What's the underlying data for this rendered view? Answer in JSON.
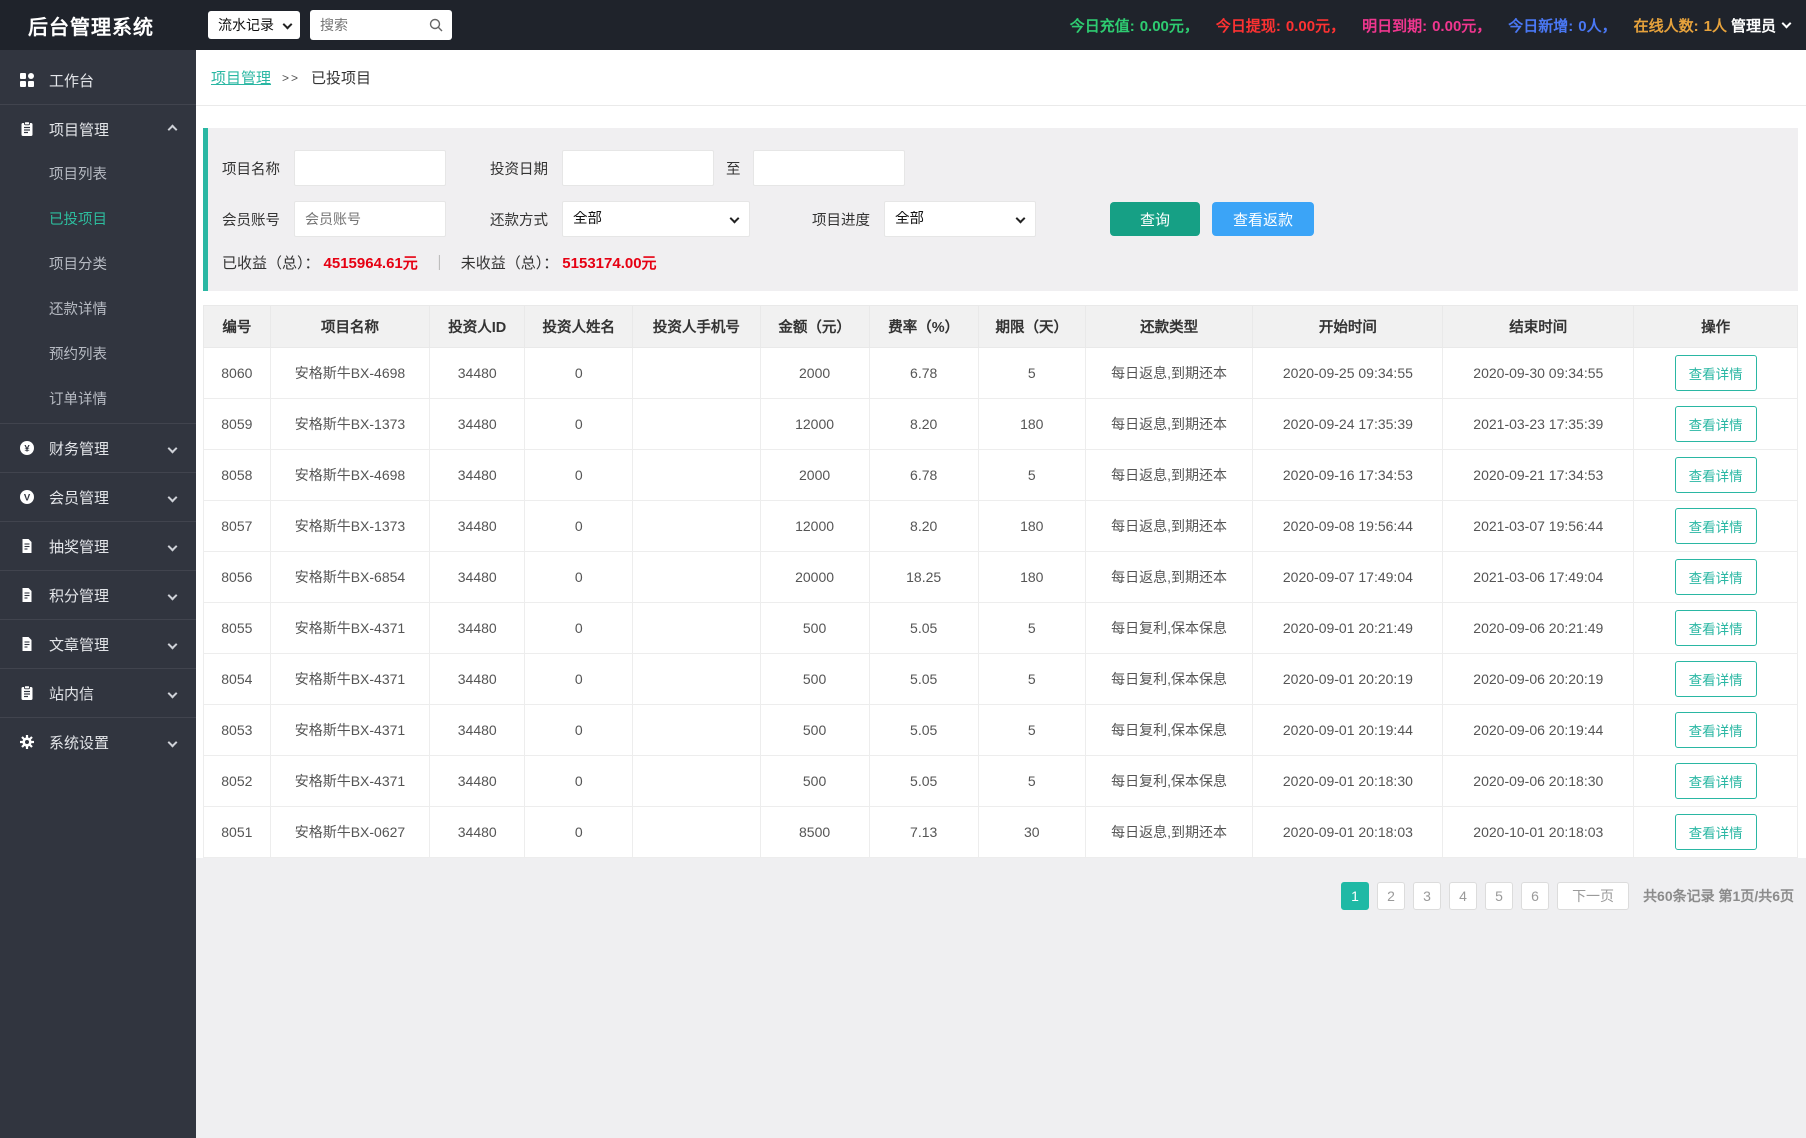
{
  "colors": {
    "accent": "#2ab7a3",
    "accent_dark": "#16a085",
    "blue": "#3ba4f7",
    "money_red": "#e60012"
  },
  "header": {
    "title": "后台管理系统",
    "nav_select": "流水记录",
    "search_placeholder": "搜索",
    "stats": [
      {
        "label": "今日充值:",
        "value": "0.00元，",
        "color": "#2ecc71"
      },
      {
        "label": "今日提现:",
        "value": "0.00元，",
        "color": "#fd3232"
      },
      {
        "label": "明日到期:",
        "value": "0.00元，",
        "color": "#f0368f"
      },
      {
        "label": "今日新增:",
        "value": "0人，",
        "color": "#4a78f5"
      },
      {
        "label": "在线人数:",
        "value": "1人",
        "color": "#e6a23c"
      }
    ],
    "admin_label": "管理员"
  },
  "sidebar": {
    "items": [
      {
        "key": "workbench",
        "label": "工作台",
        "icon": "dashboard-icon",
        "type": "top"
      },
      {
        "key": "project-management",
        "label": "项目管理",
        "icon": "clipboard-icon",
        "type": "group",
        "state": "expanded",
        "children": [
          {
            "key": "project-list",
            "label": "项目列表",
            "active": false
          },
          {
            "key": "invested-projects",
            "label": "已投项目",
            "active": true
          },
          {
            "key": "project-category",
            "label": "项目分类",
            "active": false
          },
          {
            "key": "repayment-details",
            "label": "还款详情",
            "active": false
          },
          {
            "key": "reservation-list",
            "label": "预约列表",
            "active": false
          },
          {
            "key": "order-details",
            "label": "订单详情",
            "active": false
          }
        ]
      },
      {
        "key": "finance-management",
        "label": "财务管理",
        "icon": "yen-circle-icon",
        "type": "group",
        "state": "collapsed"
      },
      {
        "key": "member-management",
        "label": "会员管理",
        "icon": "member-circle-icon",
        "type": "group",
        "state": "collapsed"
      },
      {
        "key": "lottery-management",
        "label": "抽奖管理",
        "icon": "document-icon",
        "type": "group",
        "state": "collapsed"
      },
      {
        "key": "points-management",
        "label": "积分管理",
        "icon": "document-icon",
        "type": "group",
        "state": "collapsed"
      },
      {
        "key": "article-management",
        "label": "文章管理",
        "icon": "document-icon",
        "type": "group",
        "state": "collapsed"
      },
      {
        "key": "site-mail",
        "label": "站内信",
        "icon": "clipboard-icon",
        "type": "group",
        "state": "collapsed"
      },
      {
        "key": "system-settings",
        "label": "系统设置",
        "icon": "gear-icon",
        "type": "group",
        "state": "collapsed"
      }
    ]
  },
  "breadcrumb": {
    "parent": "项目管理",
    "separator": ">>",
    "current": "已投项目"
  },
  "filters": {
    "project_name_label": "项目名称",
    "invest_date_label": "投资日期",
    "to_label": "至",
    "member_account_label": "会员账号",
    "member_account_placeholder": "会员账号",
    "repay_method_label": "还款方式",
    "repay_method_value": "全部",
    "progress_label": "项目进度",
    "progress_value": "全部",
    "query_button": "查询",
    "refund_button": "查看返款",
    "earned_label": "已收益（总）：",
    "earned_value": "4515964.61元",
    "totals_separator": "｜",
    "unearned_label": "未收益（总）：",
    "unearned_value": "5153174.00元"
  },
  "table": {
    "columns": [
      "编号",
      "项目名称",
      "投资人ID",
      "投资人姓名",
      "投资人手机号",
      "金额（元）",
      "费率（%）",
      "期限（天）",
      "还款类型",
      "开始时间",
      "结束时间",
      "操作"
    ],
    "action_label": "查看详情",
    "rows": [
      [
        "8060",
        "安格斯牛BX-4698",
        "34480",
        "0",
        "",
        "2000",
        "6.78",
        "5",
        "每日返息,到期还本",
        "2020-09-25 09:34:55",
        "2020-09-30 09:34:55"
      ],
      [
        "8059",
        "安格斯牛BX-1373",
        "34480",
        "0",
        "",
        "12000",
        "8.20",
        "180",
        "每日返息,到期还本",
        "2020-09-24 17:35:39",
        "2021-03-23 17:35:39"
      ],
      [
        "8058",
        "安格斯牛BX-4698",
        "34480",
        "0",
        "",
        "2000",
        "6.78",
        "5",
        "每日返息,到期还本",
        "2020-09-16 17:34:53",
        "2020-09-21 17:34:53"
      ],
      [
        "8057",
        "安格斯牛BX-1373",
        "34480",
        "0",
        "",
        "12000",
        "8.20",
        "180",
        "每日返息,到期还本",
        "2020-09-08 19:56:44",
        "2021-03-07 19:56:44"
      ],
      [
        "8056",
        "安格斯牛BX-6854",
        "34480",
        "0",
        "",
        "20000",
        "18.25",
        "180",
        "每日返息,到期还本",
        "2020-09-07 17:49:04",
        "2021-03-06 17:49:04"
      ],
      [
        "8055",
        "安格斯牛BX-4371",
        "34480",
        "0",
        "",
        "500",
        "5.05",
        "5",
        "每日复利,保本保息",
        "2020-09-01 20:21:49",
        "2020-09-06 20:21:49"
      ],
      [
        "8054",
        "安格斯牛BX-4371",
        "34480",
        "0",
        "",
        "500",
        "5.05",
        "5",
        "每日复利,保本保息",
        "2020-09-01 20:20:19",
        "2020-09-06 20:20:19"
      ],
      [
        "8053",
        "安格斯牛BX-4371",
        "34480",
        "0",
        "",
        "500",
        "5.05",
        "5",
        "每日复利,保本保息",
        "2020-09-01 20:19:44",
        "2020-09-06 20:19:44"
      ],
      [
        "8052",
        "安格斯牛BX-4371",
        "34480",
        "0",
        "",
        "500",
        "5.05",
        "5",
        "每日复利,保本保息",
        "2020-09-01 20:18:30",
        "2020-09-06 20:18:30"
      ],
      [
        "8051",
        "安格斯牛BX-0627",
        "34480",
        "0",
        "",
        "8500",
        "7.13",
        "30",
        "每日返息,到期还本",
        "2020-09-01 20:18:03",
        "2020-10-01 20:18:03"
      ]
    ]
  },
  "pagination": {
    "pages": [
      "1",
      "2",
      "3",
      "4",
      "5",
      "6"
    ],
    "active": "1",
    "next_label": "下一页",
    "summary_records": "共60条记录",
    "summary_pages": "第1页/共6页"
  }
}
